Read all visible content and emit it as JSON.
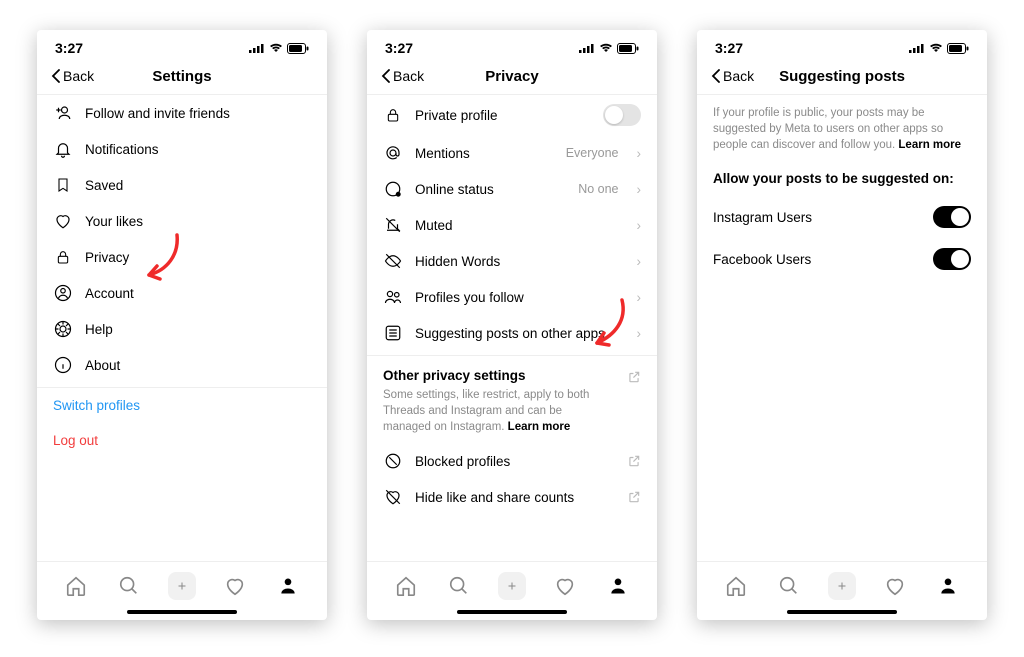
{
  "status": {
    "time": "3:27"
  },
  "screen1": {
    "back": "Back",
    "title": "Settings",
    "items": [
      {
        "label": "Follow and invite friends"
      },
      {
        "label": "Notifications"
      },
      {
        "label": "Saved"
      },
      {
        "label": "Your likes"
      },
      {
        "label": "Privacy"
      },
      {
        "label": "Account"
      },
      {
        "label": "Help"
      },
      {
        "label": "About"
      }
    ],
    "switch_profiles": "Switch profiles",
    "log_out": "Log out"
  },
  "screen2": {
    "back": "Back",
    "title": "Privacy",
    "rows": [
      {
        "label": "Private profile",
        "toggle": false
      },
      {
        "label": "Mentions",
        "value": "Everyone"
      },
      {
        "label": "Online status",
        "value": "No one"
      },
      {
        "label": "Muted"
      },
      {
        "label": "Hidden Words"
      },
      {
        "label": "Profiles you follow"
      },
      {
        "label": "Suggesting posts on other apps"
      }
    ],
    "other_title": "Other privacy settings",
    "other_desc": "Some settings, like restrict, apply to both Threads and Instagram and can be managed on Instagram.",
    "learn": "Learn more",
    "ext_rows": [
      {
        "label": "Blocked profiles"
      },
      {
        "label": "Hide like and share counts"
      }
    ]
  },
  "screen3": {
    "back": "Back",
    "title": "Suggesting posts",
    "info": "If your profile is public, your posts may be suggested by Meta to users on other apps so people can discover and follow you.",
    "learn": "Learn more",
    "allow_title": "Allow your posts to be suggested on:",
    "opts": [
      {
        "label": "Instagram Users",
        "on": true
      },
      {
        "label": "Facebook Users",
        "on": true
      }
    ]
  }
}
